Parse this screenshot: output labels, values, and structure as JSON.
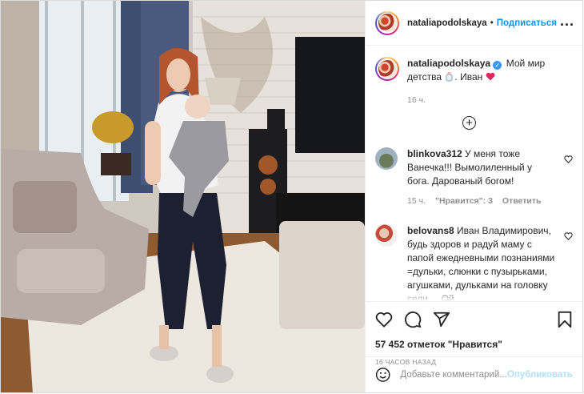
{
  "header": {
    "username": "nataliapodolskaya",
    "separator": "•",
    "follow_label": "Подписаться",
    "more_label": "..."
  },
  "caption": {
    "username": "nataliapodolskaya",
    "verified_glyph": "✓",
    "text": "Мой мир детства",
    "text2": ". Иван",
    "emoji_icon": "baby-bottle-icon",
    "heart_icon": "red-heart-icon",
    "time": "16 ч."
  },
  "load_more_icon": "plus-circle-icon",
  "comments": [
    {
      "username": "blinkova312",
      "text": "У меня тоже Ванечка!!! Вымолиленный у бога. Дарованый богом!",
      "time": "15 ч.",
      "likes": "\"Нравится\": 3",
      "reply": "Ответить"
    },
    {
      "username": "belovans8",
      "text": "Иван Владимирович, будь здоров и радуй маму с папой ежедневными познаниями =дульки, слюнки с пузырьками, агушками, дульками на головку сели ... Ой"
    }
  ],
  "actions": {
    "icons": [
      "heart-icon",
      "comment-icon",
      "share-icon",
      "bookmark-icon"
    ],
    "likes": "57 452 отметок \"Нравится\"",
    "ago": "16 ЧАСОВ НАЗАД"
  },
  "add_comment": {
    "emoji_icon": "smiley-icon",
    "placeholder": "Добавьте комментарий...",
    "publish_label": "Опубликовать"
  },
  "colors": {
    "accent": "#0095f6",
    "publish_disabled": "#b2dffc",
    "heart_red": "#ed4956",
    "muted": "#8e8e8e"
  }
}
